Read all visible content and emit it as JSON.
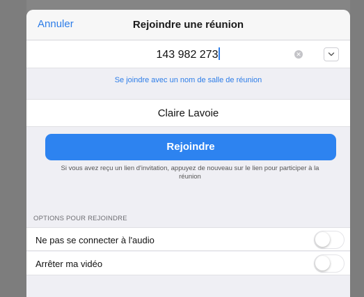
{
  "navbar": {
    "cancel_label": "Annuler",
    "title": "Rejoindre une réunion"
  },
  "meeting_id": {
    "value": "143 982 273",
    "clear_icon": "clear-circle-icon",
    "dropdown_icon": "chevron-down-icon"
  },
  "join_with_room_name_link": "Se joindre avec un nom de salle de réunion",
  "display_name": {
    "value": "Claire Lavoie"
  },
  "join_button_label": "Rejoindre",
  "hint_text": "Si vous avez reçu un lien d'invitation, appuyez de nouveau sur le lien pour participer à la réunion",
  "options": {
    "header": "OPTIONS POUR REJOINDRE",
    "items": [
      {
        "label": "Ne pas se connecter à l'audio",
        "enabled": false
      },
      {
        "label": "Arrêter ma vidéo",
        "enabled": false
      }
    ]
  },
  "colors": {
    "accent": "#2d83f0",
    "link": "#2d7de8",
    "background": "#efeff4"
  }
}
